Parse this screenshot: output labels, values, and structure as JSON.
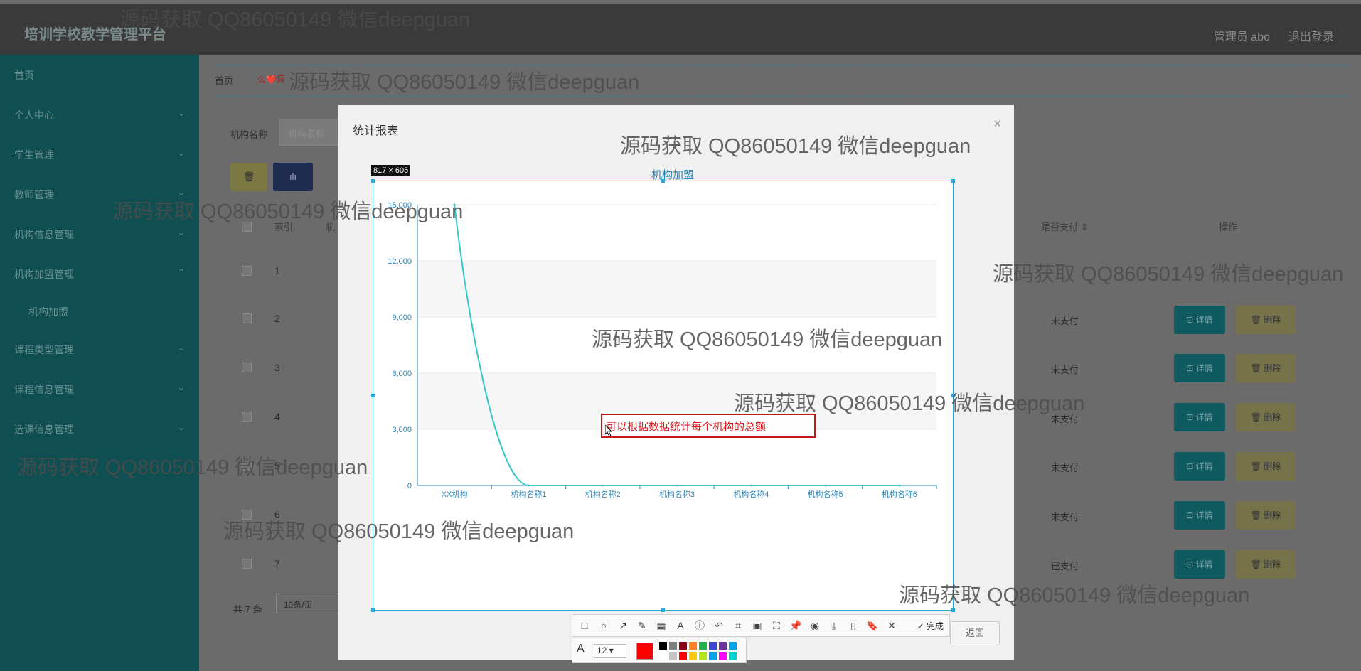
{
  "app": {
    "brand": "培训学校教学管理平台",
    "user_label": "管理员 abo",
    "logout_label": "退出登录"
  },
  "sidebar": {
    "items": [
      {
        "label": "首页",
        "has_chevron": false
      },
      {
        "label": "个人中心",
        "has_chevron": true
      },
      {
        "label": "学生管理",
        "has_chevron": true
      },
      {
        "label": "教师管理",
        "has_chevron": true
      },
      {
        "label": "机构信息管理",
        "has_chevron": true
      },
      {
        "label": "机构加盟管理",
        "has_chevron": true,
        "expanded": true
      },
      {
        "label": "机构加盟",
        "sub": true
      },
      {
        "label": "课程类型管理",
        "has_chevron": true
      },
      {
        "label": "课程信息管理",
        "has_chevron": true
      },
      {
        "label": "选课信息管理",
        "has_chevron": true
      }
    ]
  },
  "breadcrumb": {
    "home": "首页",
    "current": "么❤️异"
  },
  "filter": {
    "label": "机构名称",
    "placeholder": "机构名称"
  },
  "toolbar_buttons": {
    "delete_icon": "🗑",
    "chart_icon": "ılı"
  },
  "table": {
    "headers": {
      "index": "索引",
      "name_partial": "机",
      "paid": "是否支付 ⇕",
      "actions": "操作"
    },
    "rows": [
      {
        "index": "1",
        "paid": ""
      },
      {
        "index": "2",
        "paid": "未支付"
      },
      {
        "index": "3",
        "paid": "未支付"
      },
      {
        "index": "4",
        "paid": "未支付"
      },
      {
        "index": "5",
        "paid": "未支付"
      },
      {
        "index": "6",
        "paid": "未支付"
      },
      {
        "index": "7",
        "paid": "已支付"
      }
    ],
    "detail_label": "⊡ 详情",
    "delete_label": "🗑 删除"
  },
  "pagination": {
    "total": "共 7 条",
    "page_size": "10条/页"
  },
  "modal": {
    "title": "统计报表",
    "close": "×",
    "back_label": "返回"
  },
  "capture": {
    "size_label": "817 × 605",
    "annotation_text": "可以根据数据统计每个机构的总额"
  },
  "chart_data": {
    "type": "line",
    "title": "机构加盟",
    "categories": [
      "XX机构",
      "机构名称1",
      "机构名称2",
      "机构名称3",
      "机构名称4",
      "机构名称5",
      "机构名称6"
    ],
    "series": [
      {
        "values": [
          15000,
          0,
          0,
          0,
          0,
          0,
          0
        ],
        "smooth": true
      }
    ],
    "ylim": [
      0,
      15000
    ],
    "yticks": [
      "0",
      "3,000",
      "6,000",
      "9,000",
      "12,000",
      "15,000"
    ],
    "grid": true,
    "color": "#36c6c6"
  },
  "screenshot_toolbar": {
    "tools": [
      "rect-icon",
      "circle-icon",
      "arrow-icon",
      "pen-icon",
      "mosaic-icon",
      "text-icon",
      "number-icon",
      "undo-icon",
      "crop-icon",
      "ocr-icon",
      "scan-icon",
      "pin-icon",
      "record-icon",
      "save-icon",
      "phone-icon",
      "bookmark-icon",
      "close-icon"
    ],
    "glyphs": [
      "□",
      "○",
      "↗",
      "✎",
      "▦",
      "A",
      "ⓘ",
      "↶",
      "⌗",
      "▣",
      "⛶",
      "📌",
      "◉",
      "⤓",
      "▯",
      "🔖",
      "✕"
    ],
    "done_label": "✓ 完成",
    "font_size": "12",
    "swatches": [
      "#000000",
      "#7f7f7f",
      "#880015",
      "#ff7f27",
      "#22b14c",
      "#3f48cc",
      "#7030a0",
      "#00a2e8",
      "#ffffff",
      "#c3c3c3",
      "#ff0000",
      "#ffc90e",
      "#b5e61d",
      "#00a2e8",
      "#ff00ff",
      "#00d0d0"
    ]
  },
  "watermarks": [
    "源码获取 QQ86050149 微信deepguan",
    "源码获取 QQ86050149 微信deepguan",
    "源码获取 QQ86050149 微信deepguan",
    "源码获取 QQ86050149 微信deepguan",
    "源码获取 QQ86050149 微信deepguan",
    "源码获取 QQ86050149 微信deepguan",
    "源码获取 QQ86050149 微信deepguan",
    "源码获取 QQ86050149 微信deepguan",
    "源码获取 QQ86050149 微信deepguan",
    "源码获取 QQ86050149 微信deepguan"
  ]
}
